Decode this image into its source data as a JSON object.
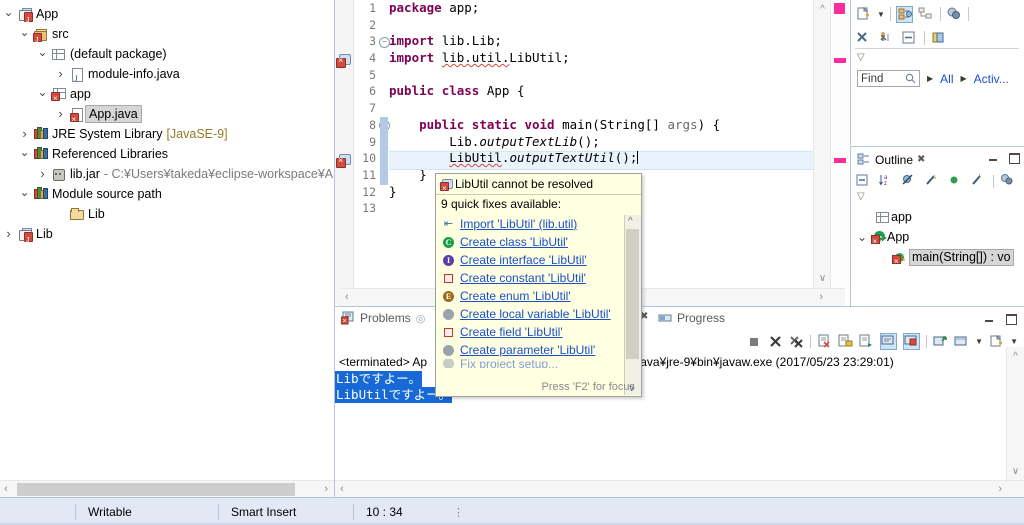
{
  "package_explorer": {
    "name": "Package Explorer",
    "tree": [
      {
        "label": "App",
        "icon": "java-project-icon",
        "indent": 0,
        "state": "open",
        "selected": false
      },
      {
        "label": "src",
        "icon": "source-folder-icon",
        "indent": 1,
        "state": "open",
        "selected": false
      },
      {
        "label": "(default package)",
        "icon": "package-icon",
        "indent": 2,
        "state": "open",
        "selected": false
      },
      {
        "label": "module-info.java",
        "icon": "java-file-icon",
        "indent": 3,
        "state": "closed",
        "selected": false
      },
      {
        "label": "app",
        "icon": "package-error-icon",
        "indent": 2,
        "state": "open",
        "selected": false
      },
      {
        "label": "App.java",
        "icon": "java-file-error-icon",
        "indent": 3,
        "state": "closed",
        "selected": true
      },
      {
        "label": "JRE System Library",
        "suffix": "[JavaSE-9]",
        "icon": "library-icon",
        "indent": 1,
        "state": "closed",
        "selected": false
      },
      {
        "label": "Referenced Libraries",
        "icon": "library-icon",
        "indent": 1,
        "state": "open",
        "selected": false
      },
      {
        "label": "lib.jar",
        "suffix": "- C:¥Users¥takeda¥eclipse-workspace¥App",
        "icon": "jar-icon",
        "indent": 2,
        "state": "closed",
        "selected": false
      },
      {
        "label": "Module source path",
        "icon": "library-icon",
        "indent": 1,
        "state": "open",
        "selected": false
      },
      {
        "label": "Lib",
        "icon": "folder-icon",
        "indent": 2,
        "state": "none",
        "selected": false
      },
      {
        "label": "Lib",
        "icon": "java-project-icon",
        "indent": 0,
        "state": "closed",
        "selected": false
      }
    ]
  },
  "editor": {
    "name": "App.java editor",
    "line_numbers": [
      "1",
      "2",
      "3",
      "4",
      "5",
      "6",
      "7",
      "8",
      "9",
      "10",
      "11",
      "12",
      "13"
    ],
    "lines": [
      {
        "n": 1,
        "text": "package app;"
      },
      {
        "n": 2,
        "text": ""
      },
      {
        "n": 3,
        "text": "import lib.Lib;"
      },
      {
        "n": 4,
        "text": "import lib.util.LibUtil;"
      },
      {
        "n": 5,
        "text": ""
      },
      {
        "n": 6,
        "text": "public class App {"
      },
      {
        "n": 7,
        "text": ""
      },
      {
        "n": 8,
        "text": "    public static void main(String[] args) {"
      },
      {
        "n": 9,
        "text": "        Lib.outputTextLib();"
      },
      {
        "n": 10,
        "text": "        LibUtil.outputTextUtil();"
      },
      {
        "n": 11,
        "text": "    }"
      },
      {
        "n": 12,
        "text": "}"
      },
      {
        "n": 13,
        "text": ""
      }
    ],
    "tokens": {
      "kw_package": "package",
      "kw_import": "import",
      "kw_public": "public",
      "kw_class": "class",
      "kw_static": "static",
      "kw_void": "void",
      "app": "app;",
      "lib_Lib": "lib.Lib;",
      "lib_util": "lib.util.",
      "LibUtil_imp": "LibUtil;",
      "class_App": "App {",
      "main_sig": "main(String[] ",
      "args": "args",
      "main_tail": ") {",
      "lib_call_obj": "Lib.",
      "lib_call_m": "outputTextLib",
      "call_tail": "();",
      "libutil_obj": "LibUtil",
      "dot": ".",
      "libutil_m": "outputTextUtil",
      "brace_close_inner": "    }",
      "brace_close_outer": "}"
    },
    "error_marker_lines": [
      4,
      10
    ],
    "current_line": 10,
    "change_bar_lines": [
      8,
      9,
      10,
      11
    ],
    "fold_markers": [
      3,
      8
    ]
  },
  "quickfix_popup": {
    "name": "Quick fix hover popup",
    "title": "LibUtil cannot be resolved",
    "count_text": "9 quick fixes available:",
    "items": [
      {
        "label": "Import 'LibUtil' (lib.util)",
        "icon": "import-icon"
      },
      {
        "label": "Create class 'LibUtil'",
        "icon": "class-icon"
      },
      {
        "label": "Create interface 'LibUtil'",
        "icon": "interface-icon"
      },
      {
        "label": "Create constant 'LibUtil'",
        "icon": "constant-icon"
      },
      {
        "label": "Create enum 'LibUtil'",
        "icon": "enum-icon"
      },
      {
        "label": "Create local variable 'LibUtil'",
        "icon": "variable-icon"
      },
      {
        "label": "Create field 'LibUtil'",
        "icon": "field-icon"
      },
      {
        "label": "Create parameter 'LibUtil'",
        "icon": "parameter-icon"
      },
      {
        "label": "Fix project setup...",
        "icon": "fix-icon"
      }
    ],
    "footer": "Press 'F2' for focus"
  },
  "right_top_panel": {
    "name": "Java browsing panel",
    "toolbar_row1": [
      "new-wizard-icon",
      "dropdown-arrow-icon",
      "link-with-editor-icon",
      "hierarchy-icon",
      "filter-icon"
    ],
    "toolbar_row2": [
      "cut-icon",
      "run-icon",
      "collapse-all-icon",
      "refresh-icon"
    ],
    "collapse_icon": "collapse-arrow-icon",
    "find": {
      "placeholder": "Find",
      "search_icon": "search-icon",
      "scope_all": "All",
      "scope_active": "Activ..."
    }
  },
  "outline": {
    "name": "Outline view",
    "tab_label": "Outline",
    "tab_close_icon": "close-icon",
    "window_buttons": [
      "minimize-icon",
      "maximize-icon"
    ],
    "toolbar": [
      "collapse-all-icon",
      "sort-icon",
      "hide-fields-icon",
      "hide-static-icon",
      "hide-nonpublic-icon",
      "hide-local-types-icon",
      "filter-icon"
    ],
    "collapse_icon": "collapse-arrow-icon",
    "tree": [
      {
        "label": "app",
        "icon": "package-icon",
        "indent": 1,
        "state": "none",
        "selected": false
      },
      {
        "label": "App",
        "icon": "class-error-icon",
        "indent": 0,
        "state": "open",
        "selected": false
      },
      {
        "label": "main(String[]) : vo",
        "icon": "method-error-icon",
        "indent": 2,
        "state": "none",
        "selected": true
      }
    ]
  },
  "bottom_panel": {
    "name": "Problems and Console panel",
    "tabs": [
      {
        "label": "Problems",
        "icon": "problems-icon",
        "active": false
      },
      {
        "label": "Progress",
        "icon": "progress-icon",
        "active": false
      }
    ],
    "window_buttons": [
      "minimize-icon",
      "maximize-icon"
    ],
    "toolbar": [
      "terminate-icon",
      "remove-launch-icon",
      "remove-all-icon",
      "clear-console-icon",
      "scroll-lock-icon",
      "show-console-icon",
      "pin-console-icon",
      "display-selected-console-icon",
      "open-console-icon",
      "new-console-view-icon",
      "view-menu-icon"
    ],
    "terminated_line": "<terminated> Ap",
    "terminated_line_right": "¥Java¥jre-9¥bin¥javaw.exe (2017/05/23 23:29:01)",
    "console_output": [
      "Libですよー。",
      "LibUtilですよー。"
    ]
  },
  "status_bar": {
    "name": "Status bar",
    "writable": "Writable",
    "insert_mode": "Smart Insert",
    "cursor_position": "10 : 34",
    "menu_icon": "vertical-dots-icon"
  },
  "colors": {
    "keyword": "#7f0055",
    "error": "#d24b3e",
    "link": "#1a4fd0",
    "popup_bg": "#ffffe1",
    "selection": "#1669d6",
    "overview_marker": "#ff2d9b",
    "current_line": "#eaf2fb"
  }
}
